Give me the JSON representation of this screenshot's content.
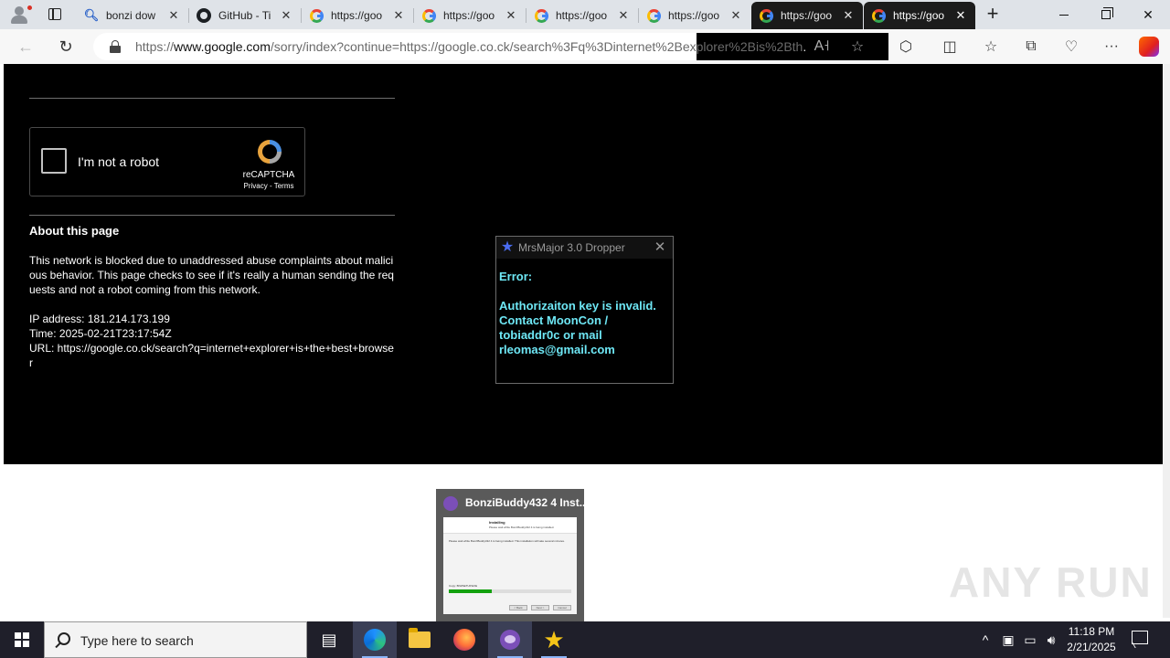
{
  "browser": {
    "tabs": [
      {
        "title": "bonzi dow",
        "icon": "search-icon",
        "theme": "light"
      },
      {
        "title": "GitHub - Ti",
        "icon": "github-icon",
        "theme": "light"
      },
      {
        "title": "https://goo",
        "icon": "google-icon",
        "theme": "light"
      },
      {
        "title": "https://goo",
        "icon": "google-icon",
        "theme": "light"
      },
      {
        "title": "https://goo",
        "icon": "google-icon",
        "theme": "light"
      },
      {
        "title": "https://goo",
        "icon": "google-icon",
        "theme": "light"
      },
      {
        "title": "https://goo",
        "icon": "google-icon",
        "theme": "dark"
      },
      {
        "title": "https://goo",
        "icon": "google-icon",
        "theme": "active"
      }
    ],
    "new_tab_symbol": "+",
    "address": {
      "prefix": "https://",
      "host": "www.google.com",
      "path": "/sorry/index?continue=https://google.co.ck/search%3Fq%3Dinternet%2Bexplorer%2Bis%2Bth",
      "tail": "..."
    }
  },
  "page": {
    "captcha_label": "I'm not a robot",
    "captcha_brand": "reCAPTCHA",
    "captcha_terms": "Privacy - Terms",
    "about_heading": "About this page",
    "about_text": "This network is blocked due to unaddressed abuse complaints about malicious behavior. This page checks to see if it's really a human sending the requests and not a robot coming from this network.",
    "ip_line": "IP address: 181.214.173.199",
    "time_line": "Time: 2025-02-21T23:17:54Z",
    "url_line": "URL: https://google.co.ck/search?q=internet+explorer+is+the+best+browser"
  },
  "dialog": {
    "title": "MrsMajor 3.0 Dropper",
    "error_label": "Error:",
    "message": "Authorizaiton key is invalid. Contact MoonCon / tobiaddr0c or mail rleomas@gmail.com"
  },
  "thumbnail": {
    "title": "BonziBuddy432 4 Inst...",
    "preview_heading": "Installing",
    "preview_subheading": "Please wait while BonziBuddy432 4 is being installed.",
    "preview_body": "Please wait while BonziBuddy432 4 is being installed. This installation will take several minutes.",
    "preview_status": "Copy: BNZSETUP.EXE",
    "progress": 0.35,
    "preview_buttons": [
      "< Back",
      "Next >",
      "Cancel"
    ]
  },
  "watermark": "ANY RUN",
  "taskbar": {
    "search_placeholder": "Type here to search",
    "time": "11:18 PM",
    "date": "2/21/2025"
  }
}
